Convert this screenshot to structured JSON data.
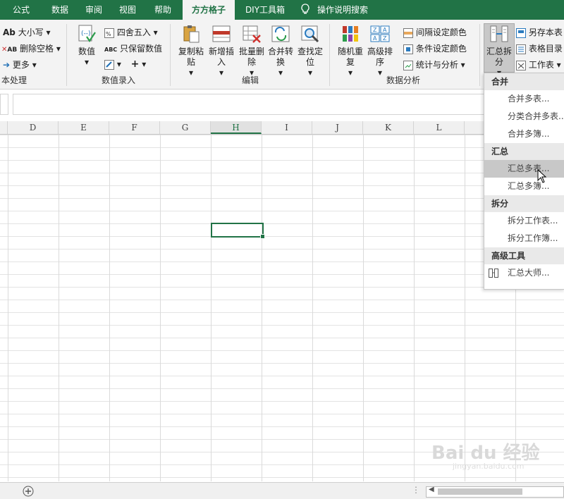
{
  "tabs": [
    "公式",
    "数据",
    "审阅",
    "视图",
    "帮助",
    "方方格子",
    "DIY工具箱",
    "操作说明搜索"
  ],
  "ribbon": {
    "text_group": {
      "title": "本处理",
      "case": "大小写",
      "case_icon": "Ab",
      "delete_space": "删除空格",
      "delete_space_icon": "AB",
      "more": "更多"
    },
    "numeric_group": {
      "title": "数值录入",
      "value": "数值",
      "round": "四舍五入",
      "keep_value": "只保留数值",
      "abc_icon": "ABC"
    },
    "edit_group": {
      "title": "编辑",
      "copy_paste": "复制粘贴",
      "add_insert": "新增插入",
      "batch_delete": "批量删除",
      "merge_convert": "合并转换",
      "find_locate": "查找定位"
    },
    "analysis_group": {
      "title": "数据分析",
      "random_repeat": "随机重复",
      "advanced_sort": "高级排序",
      "interval_color": "间隔设定颜色",
      "cond_color": "条件设定颜色",
      "stats": "统计与分析"
    },
    "summary_group": {
      "summary_split": "汇总拆分",
      "save_sheet": "另存本表",
      "table_dir": "表格目录",
      "worksheet": "工作表"
    }
  },
  "columns": [
    "D",
    "E",
    "F",
    "G",
    "H",
    "I",
    "J",
    "K",
    "L"
  ],
  "selected_column": "H",
  "dropdown": {
    "sections": [
      {
        "title": "合并",
        "items": [
          "合并多表...",
          "分类合并多表...",
          "合并多簿..."
        ]
      },
      {
        "title": "汇总",
        "items": [
          "汇总多表...",
          "汇总多簿..."
        ]
      },
      {
        "title": "拆分",
        "items": [
          "拆分工作表...",
          "拆分工作簿..."
        ]
      },
      {
        "title": "高级工具",
        "items": [
          "汇总大师..."
        ]
      }
    ],
    "hover_item": "汇总多表..."
  },
  "watermark": {
    "text": "Bai du 经验",
    "sub": "jingyan.baidu.com"
  },
  "colors": {
    "accent": "#217346",
    "ribbon_bg": "#f3f3f3",
    "hover": "#c8c8c8"
  }
}
